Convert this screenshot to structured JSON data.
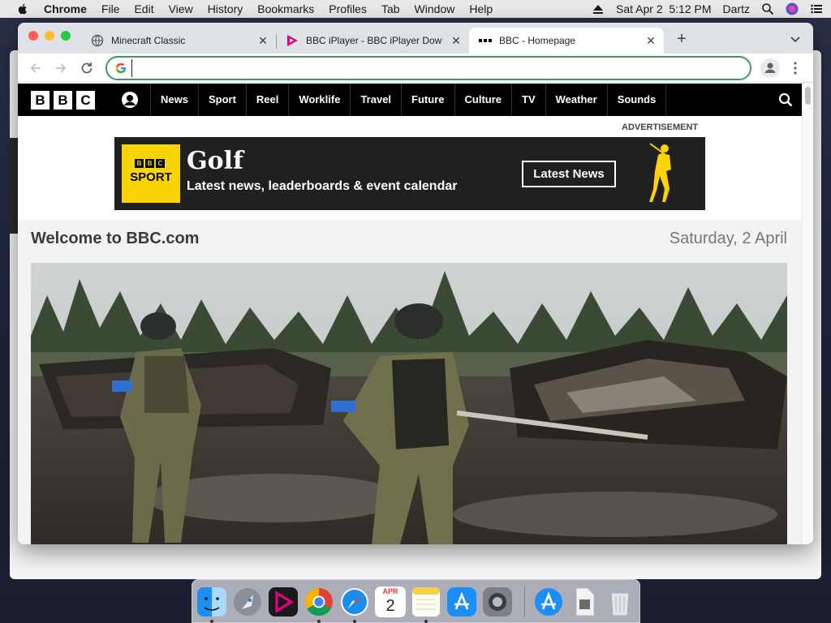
{
  "menubar": {
    "app": "Chrome",
    "items": [
      "File",
      "Edit",
      "View",
      "History",
      "Bookmarks",
      "Profiles",
      "Tab",
      "Window",
      "Help"
    ],
    "datetime": "Sat Apr 2  5:12 PM",
    "user": "Dartz"
  },
  "tabs": [
    {
      "title": "Minecraft Classic",
      "favicon": "globe-icon"
    },
    {
      "title": "BBC iPlayer - BBC iPlayer Dow",
      "favicon": "iplayer-icon"
    },
    {
      "title": "BBC - Homepage",
      "favicon": "bbc-icon"
    }
  ],
  "omnibox": {
    "value": "",
    "placeholder": ""
  },
  "bbc": {
    "logo": [
      "B",
      "B",
      "C"
    ],
    "nav": [
      "News",
      "Sport",
      "Reel",
      "Worklife",
      "Travel",
      "Future",
      "Culture",
      "TV",
      "Weather",
      "Sounds"
    ]
  },
  "ad": {
    "label": "ADVERTISEMENT",
    "brand_top": [
      "B",
      "B",
      "C"
    ],
    "brand": "SPORT",
    "title": "Golf",
    "subtitle": "Latest news, leaderboards & event calendar",
    "button": "Latest News",
    "accent": "#fad305"
  },
  "welcome": {
    "title": "Welcome to BBC.com",
    "date": "Saturday, 2 April"
  },
  "dock": {
    "apps": [
      "finder-icon",
      "launchpad-icon",
      "davinci-icon",
      "chrome-icon",
      "safari-icon",
      "calendar-icon",
      "notes-icon",
      "app-store-icon",
      "system-preferences-icon",
      "app-store-folder-icon",
      "document-icon",
      "trash-icon"
    ],
    "calendar": {
      "month": "APR",
      "day": "2"
    }
  }
}
